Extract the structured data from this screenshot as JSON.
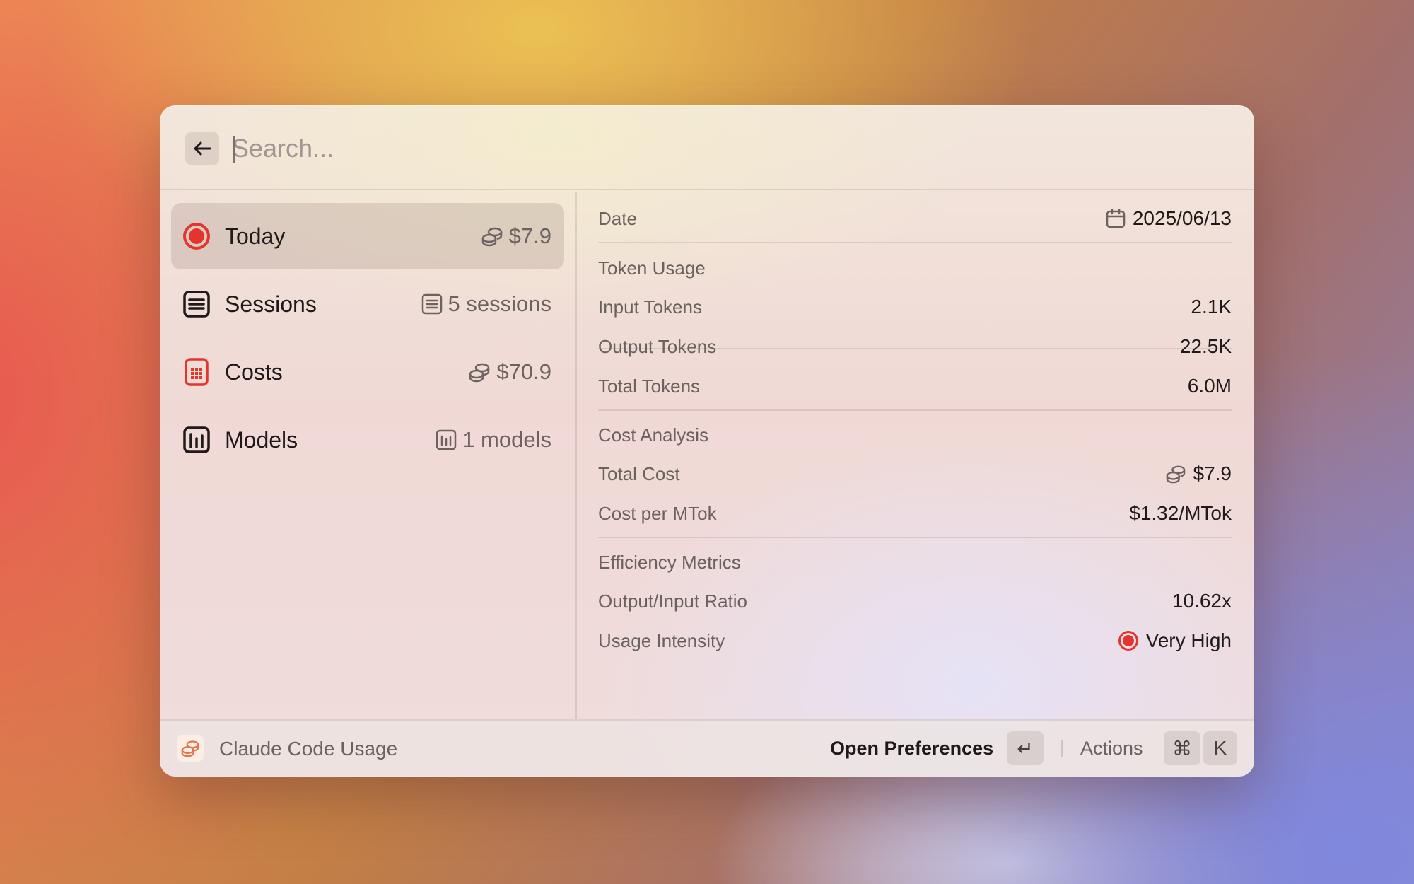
{
  "search": {
    "placeholder": "Search..."
  },
  "list": {
    "items": [
      {
        "label": "Today",
        "icon": "record-circle-icon",
        "accessory": "$7.9",
        "accessory_icon": "coins-icon",
        "selected": true
      },
      {
        "label": "Sessions",
        "icon": "document-list-icon",
        "accessory": "5 sessions",
        "accessory_icon": "document-list-icon"
      },
      {
        "label": "Costs",
        "icon": "calculator-icon",
        "accessory": "$70.9",
        "accessory_icon": "coins-icon"
      },
      {
        "label": "Models",
        "icon": "bar-chart-icon",
        "accessory": "1 models",
        "accessory_icon": "bar-chart-icon"
      }
    ]
  },
  "detail": {
    "date_label": "Date",
    "date_value": "2025/06/13",
    "token_section": "Token Usage",
    "input_tokens_label": "Input Tokens",
    "input_tokens_value": "2.1K",
    "output_tokens_label": "Output Tokens",
    "output_tokens_value": "22.5K",
    "total_tokens_label": "Total Tokens",
    "total_tokens_value": "6.0M",
    "cost_section": "Cost Analysis",
    "total_cost_label": "Total Cost",
    "total_cost_value": "$7.9",
    "cost_per_mtok_label": "Cost per MTok",
    "cost_per_mtok_value": "$1.32/MTok",
    "efficiency_section": "Efficiency Metrics",
    "ratio_label": "Output/Input Ratio",
    "ratio_value": "10.62x",
    "intensity_label": "Usage Intensity",
    "intensity_value": "Very High"
  },
  "footer": {
    "extension_title": "Claude Code Usage",
    "primary_action": "Open Preferences",
    "enter_key": "↵",
    "actions_label": "Actions",
    "cmd_key": "⌘",
    "k_key": "K"
  },
  "colors": {
    "accent_red": "#e2362c",
    "text": "#1f1a19",
    "muted": "#6b6260"
  }
}
